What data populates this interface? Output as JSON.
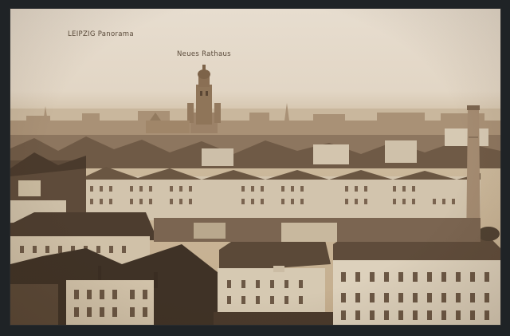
{
  "postcard": {
    "title": "LEIPZIG  Panorama",
    "subtitle": "Neues Rathaus"
  },
  "colors": {
    "sky": "#e4d9c9",
    "sepia_dark": "#4a3a2c",
    "sepia_mid": "#8c7660",
    "sepia_light": "#d9ccb8",
    "frame": "#1f2326"
  }
}
